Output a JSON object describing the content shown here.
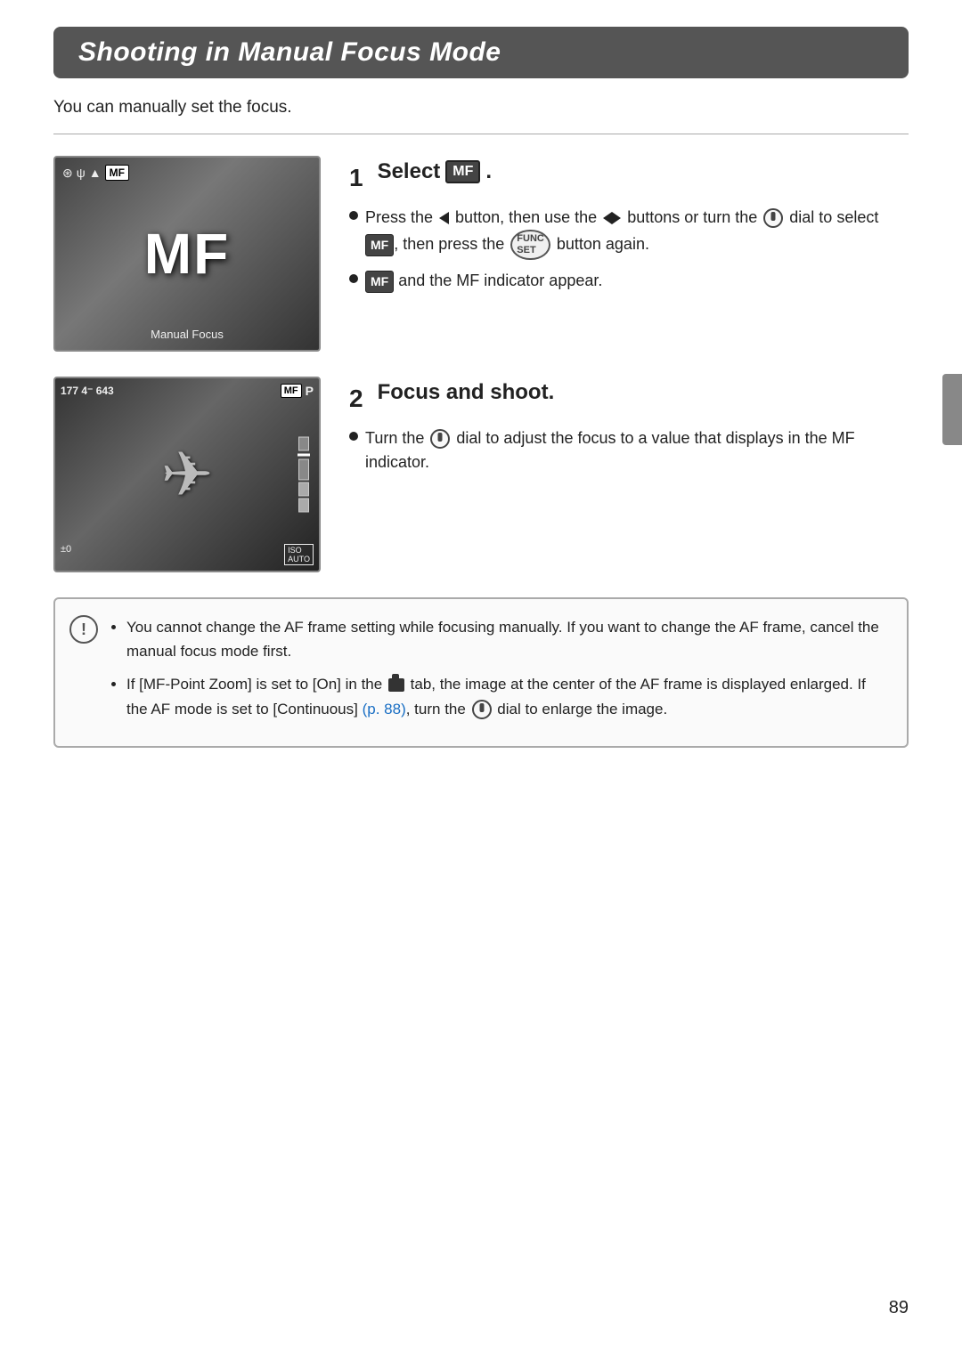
{
  "page": {
    "title": "Shooting in Manual Focus Mode",
    "subtitle": "You can manually set the focus.",
    "page_number": "89"
  },
  "step1": {
    "number": "1",
    "title_prefix": "Select",
    "title_badge": "MF",
    "bullets": [
      {
        "text_parts": [
          {
            "type": "text",
            "value": "Press the "
          },
          {
            "type": "icon",
            "value": "arrow-left"
          },
          {
            "type": "text",
            "value": " button, then use the "
          },
          {
            "type": "icon",
            "value": "arrows-lr"
          },
          {
            "type": "text",
            "value": " buttons or turn the "
          },
          {
            "type": "icon",
            "value": "dial"
          },
          {
            "type": "text",
            "value": " dial to select "
          },
          {
            "type": "badge",
            "value": "MF"
          },
          {
            "type": "text",
            "value": ", then press the "
          },
          {
            "type": "func",
            "value": "FUNC SET"
          },
          {
            "type": "text",
            "value": " button again."
          }
        ]
      },
      {
        "text_parts": [
          {
            "type": "badge",
            "value": "MF"
          },
          {
            "type": "text",
            "value": " and the MF indicator appear."
          }
        ]
      }
    ]
  },
  "step2": {
    "number": "2",
    "title": "Focus and shoot.",
    "bullets": [
      {
        "text_parts": [
          {
            "type": "text",
            "value": "Turn the "
          },
          {
            "type": "icon",
            "value": "dial"
          },
          {
            "type": "text",
            "value": " dial to adjust the focus to a value that displays in the MF indicator."
          }
        ]
      }
    ]
  },
  "notes": [
    "You cannot change the AF frame setting while focusing manually. If you want to change the AF frame, cancel the manual focus mode first.",
    "If [MF-Point Zoom] is set to [On] in the {cam} tab, the image at the center of the AF frame is displayed enlarged. If the AF mode is set to [Continuous] {link}, turn the {dial} dial to enlarge the image."
  ],
  "note_link_text": "(p. 88)",
  "cam1": {
    "top_icons": "⊛ ψ ▲ MF",
    "big_label": "MF",
    "bottom_label": "Manual Focus"
  },
  "cam2": {
    "hud_left": "177  4⁻  643",
    "hud_badge": "MF",
    "hud_mode": "P"
  }
}
